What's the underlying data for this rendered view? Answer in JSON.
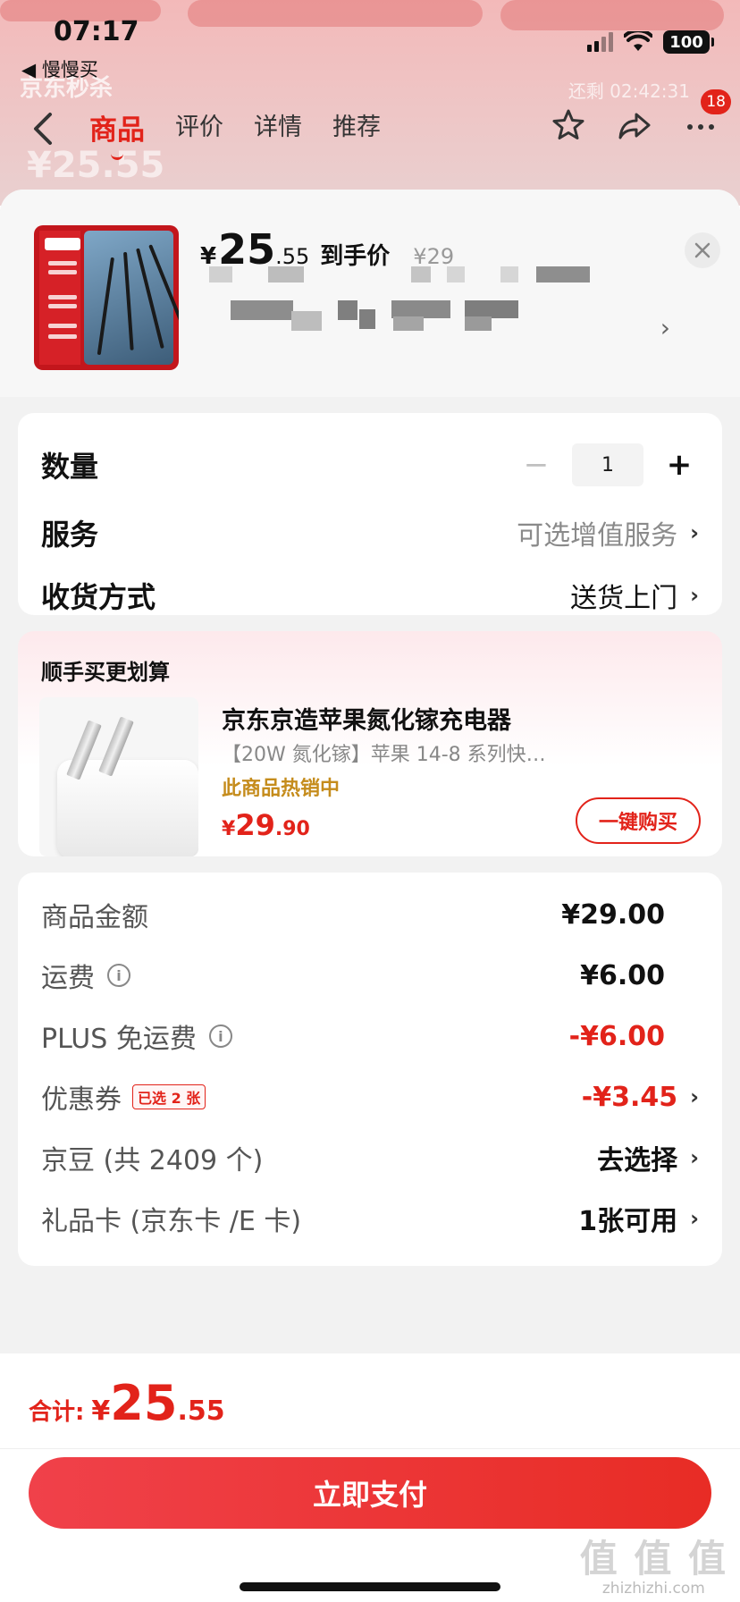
{
  "status_bar": {
    "time": "07:17",
    "back_app": "◀ 慢慢买",
    "battery": "100"
  },
  "background": {
    "banner": "京东秒杀",
    "timer": "还剩 02:42:31",
    "price": "¥25.55"
  },
  "nav": {
    "tabs": [
      "商品",
      "评价",
      "详情",
      "推荐"
    ],
    "active_tab": "商品",
    "message_badge": "18"
  },
  "product": {
    "price_symbol": "¥",
    "price_int": "25",
    "price_dec": ".55",
    "price_label": "到手价",
    "original_price": "¥29"
  },
  "options": {
    "quantity_label": "数量",
    "quantity_value": "1",
    "minus": "−",
    "plus": "+",
    "service_label": "服务",
    "service_value": "可选增值服务",
    "delivery_label": "收货方式",
    "delivery_value": "送货上门"
  },
  "upsell": {
    "title": "顺手买更划算",
    "name": "京东京造苹果氮化镓充电器",
    "subtitle": "【20W 氮化镓】苹果 14-8 系列快…",
    "hot": "此商品热销中",
    "price_symbol": "¥",
    "price_int": "29",
    "price_dec": ".90",
    "buy_button": "一键购买"
  },
  "fees": {
    "goods_label": "商品金额",
    "goods_value": "¥29.00",
    "shipping_label": "运费",
    "shipping_value": "¥6.00",
    "plus_label": "PLUS 免运费",
    "plus_value": "-¥6.00",
    "coupon_label": "优惠券",
    "coupon_tag": "已选 2 张",
    "coupon_value": "-¥3.45",
    "beans_label": "京豆 (共 2409 个)",
    "beans_value": "去选择",
    "giftcard_label": "礼品卡 (京东卡 /E 卡)",
    "giftcard_value": "1张可用"
  },
  "footer": {
    "total_label": "合计:",
    "total_symbol": "¥",
    "total_int": "25",
    "total_dec": ".55",
    "pay_button": "立即支付"
  },
  "watermark": {
    "big": "值 值 值",
    "small": "zhizhizhi.com"
  },
  "colors": {
    "accent_red": "#e2231a",
    "hot_orange": "#c58c1c"
  }
}
